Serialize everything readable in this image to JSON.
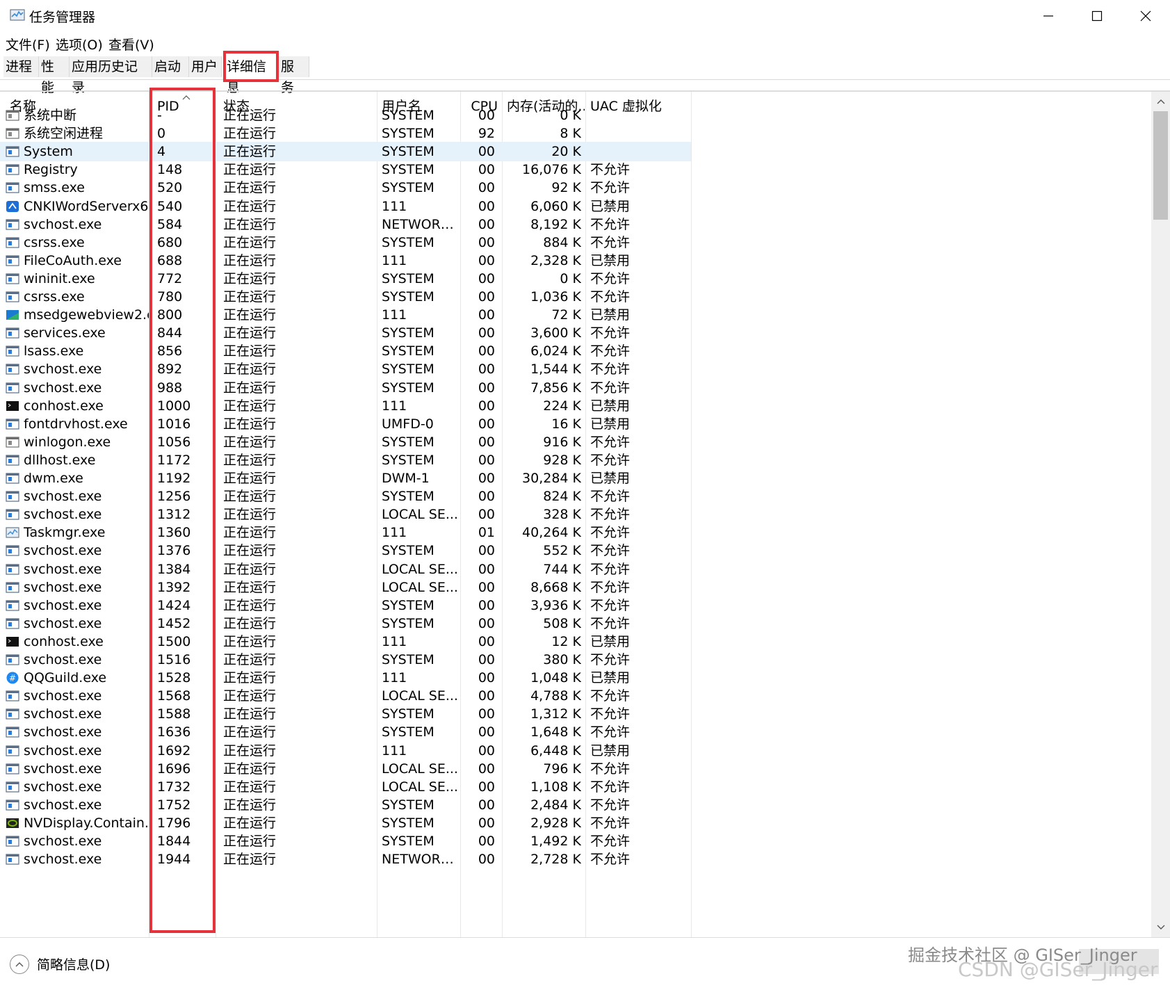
{
  "window": {
    "title": "任务管理器",
    "controls": [
      "minimize",
      "maximize",
      "close"
    ]
  },
  "menu": [
    "文件(F)",
    "选项(O)",
    "查看(V)"
  ],
  "tabs": [
    {
      "label": "进程"
    },
    {
      "label": "性能"
    },
    {
      "label": "应用历史记录"
    },
    {
      "label": "启动"
    },
    {
      "label": "用户"
    },
    {
      "label": "详细信息",
      "active": true
    },
    {
      "label": "服务"
    }
  ],
  "columns": {
    "name": "名称",
    "pid": "PID",
    "status": "状态",
    "user": "用户名",
    "cpu": "CPU",
    "mem": "内存(活动的...",
    "uac": "UAC 虚拟化"
  },
  "rows": [
    {
      "icon": "system-window-icon",
      "name": "系统中断",
      "pid": "-",
      "status": "正在运行",
      "user": "SYSTEM",
      "cpu": "00",
      "mem": "0 K",
      "uac": ""
    },
    {
      "icon": "system-window-icon",
      "name": "系统空闲进程",
      "pid": "0",
      "status": "正在运行",
      "user": "SYSTEM",
      "cpu": "92",
      "mem": "8 K",
      "uac": ""
    },
    {
      "icon": "app-window-icon",
      "name": "System",
      "pid": "4",
      "status": "正在运行",
      "user": "SYSTEM",
      "cpu": "00",
      "mem": "20 K",
      "uac": "",
      "selected": true
    },
    {
      "icon": "app-window-icon",
      "name": "Registry",
      "pid": "148",
      "status": "正在运行",
      "user": "SYSTEM",
      "cpu": "00",
      "mem": "16,076 K",
      "uac": "不允许"
    },
    {
      "icon": "app-window-icon",
      "name": "smss.exe",
      "pid": "520",
      "status": "正在运行",
      "user": "SYSTEM",
      "cpu": "00",
      "mem": "92 K",
      "uac": "不允许"
    },
    {
      "icon": "cnki-icon",
      "name": "CNKIWordServerx6...",
      "pid": "540",
      "status": "正在运行",
      "user": "111",
      "cpu": "00",
      "mem": "6,060 K",
      "uac": "已禁用"
    },
    {
      "icon": "app-window-icon",
      "name": "svchost.exe",
      "pid": "584",
      "status": "正在运行",
      "user": "NETWORK...",
      "cpu": "00",
      "mem": "8,192 K",
      "uac": "不允许"
    },
    {
      "icon": "app-window-icon",
      "name": "csrss.exe",
      "pid": "680",
      "status": "正在运行",
      "user": "SYSTEM",
      "cpu": "00",
      "mem": "884 K",
      "uac": "不允许"
    },
    {
      "icon": "app-window-icon",
      "name": "FileCoAuth.exe",
      "pid": "688",
      "status": "正在运行",
      "user": "111",
      "cpu": "00",
      "mem": "2,328 K",
      "uac": "已禁用"
    },
    {
      "icon": "app-window-icon",
      "name": "wininit.exe",
      "pid": "772",
      "status": "正在运行",
      "user": "SYSTEM",
      "cpu": "00",
      "mem": "0 K",
      "uac": "不允许"
    },
    {
      "icon": "app-window-icon",
      "name": "csrss.exe",
      "pid": "780",
      "status": "正在运行",
      "user": "SYSTEM",
      "cpu": "00",
      "mem": "1,036 K",
      "uac": "不允许"
    },
    {
      "icon": "edge-webview-icon",
      "name": "msedgewebview2.e...",
      "pid": "800",
      "status": "正在运行",
      "user": "111",
      "cpu": "00",
      "mem": "72 K",
      "uac": "已禁用"
    },
    {
      "icon": "app-window-icon",
      "name": "services.exe",
      "pid": "844",
      "status": "正在运行",
      "user": "SYSTEM",
      "cpu": "00",
      "mem": "3,600 K",
      "uac": "不允许"
    },
    {
      "icon": "app-window-icon",
      "name": "lsass.exe",
      "pid": "856",
      "status": "正在运行",
      "user": "SYSTEM",
      "cpu": "00",
      "mem": "6,024 K",
      "uac": "不允许"
    },
    {
      "icon": "app-window-icon",
      "name": "svchost.exe",
      "pid": "892",
      "status": "正在运行",
      "user": "SYSTEM",
      "cpu": "00",
      "mem": "1,544 K",
      "uac": "不允许"
    },
    {
      "icon": "app-window-icon",
      "name": "svchost.exe",
      "pid": "988",
      "status": "正在运行",
      "user": "SYSTEM",
      "cpu": "00",
      "mem": "7,856 K",
      "uac": "不允许"
    },
    {
      "icon": "console-icon",
      "name": "conhost.exe",
      "pid": "1000",
      "status": "正在运行",
      "user": "111",
      "cpu": "00",
      "mem": "224 K",
      "uac": "已禁用"
    },
    {
      "icon": "app-window-icon",
      "name": "fontdrvhost.exe",
      "pid": "1016",
      "status": "正在运行",
      "user": "UMFD-0",
      "cpu": "00",
      "mem": "16 K",
      "uac": "已禁用"
    },
    {
      "icon": "system-window-icon",
      "name": "winlogon.exe",
      "pid": "1056",
      "status": "正在运行",
      "user": "SYSTEM",
      "cpu": "00",
      "mem": "916 K",
      "uac": "不允许"
    },
    {
      "icon": "app-window-icon",
      "name": "dllhost.exe",
      "pid": "1172",
      "status": "正在运行",
      "user": "SYSTEM",
      "cpu": "00",
      "mem": "928 K",
      "uac": "不允许"
    },
    {
      "icon": "app-window-icon",
      "name": "dwm.exe",
      "pid": "1192",
      "status": "正在运行",
      "user": "DWM-1",
      "cpu": "00",
      "mem": "30,284 K",
      "uac": "已禁用"
    },
    {
      "icon": "app-window-icon",
      "name": "svchost.exe",
      "pid": "1256",
      "status": "正在运行",
      "user": "SYSTEM",
      "cpu": "00",
      "mem": "824 K",
      "uac": "不允许"
    },
    {
      "icon": "app-window-icon",
      "name": "svchost.exe",
      "pid": "1312",
      "status": "正在运行",
      "user": "LOCAL SE...",
      "cpu": "00",
      "mem": "328 K",
      "uac": "不允许"
    },
    {
      "icon": "taskmgr-icon",
      "name": "Taskmgr.exe",
      "pid": "1360",
      "status": "正在运行",
      "user": "111",
      "cpu": "01",
      "mem": "40,264 K",
      "uac": "不允许"
    },
    {
      "icon": "app-window-icon",
      "name": "svchost.exe",
      "pid": "1376",
      "status": "正在运行",
      "user": "SYSTEM",
      "cpu": "00",
      "mem": "552 K",
      "uac": "不允许"
    },
    {
      "icon": "app-window-icon",
      "name": "svchost.exe",
      "pid": "1384",
      "status": "正在运行",
      "user": "LOCAL SE...",
      "cpu": "00",
      "mem": "744 K",
      "uac": "不允许"
    },
    {
      "icon": "app-window-icon",
      "name": "svchost.exe",
      "pid": "1392",
      "status": "正在运行",
      "user": "LOCAL SE...",
      "cpu": "00",
      "mem": "8,668 K",
      "uac": "不允许"
    },
    {
      "icon": "app-window-icon",
      "name": "svchost.exe",
      "pid": "1424",
      "status": "正在运行",
      "user": "SYSTEM",
      "cpu": "00",
      "mem": "3,936 K",
      "uac": "不允许"
    },
    {
      "icon": "app-window-icon",
      "name": "svchost.exe",
      "pid": "1452",
      "status": "正在运行",
      "user": "SYSTEM",
      "cpu": "00",
      "mem": "508 K",
      "uac": "不允许"
    },
    {
      "icon": "console-icon",
      "name": "conhost.exe",
      "pid": "1500",
      "status": "正在运行",
      "user": "111",
      "cpu": "00",
      "mem": "12 K",
      "uac": "已禁用"
    },
    {
      "icon": "app-window-icon",
      "name": "svchost.exe",
      "pid": "1516",
      "status": "正在运行",
      "user": "SYSTEM",
      "cpu": "00",
      "mem": "380 K",
      "uac": "不允许"
    },
    {
      "icon": "qqguild-icon",
      "name": "QQGuild.exe",
      "pid": "1528",
      "status": "正在运行",
      "user": "111",
      "cpu": "00",
      "mem": "1,048 K",
      "uac": "已禁用"
    },
    {
      "icon": "app-window-icon",
      "name": "svchost.exe",
      "pid": "1568",
      "status": "正在运行",
      "user": "LOCAL SE...",
      "cpu": "00",
      "mem": "4,788 K",
      "uac": "不允许"
    },
    {
      "icon": "app-window-icon",
      "name": "svchost.exe",
      "pid": "1588",
      "status": "正在运行",
      "user": "SYSTEM",
      "cpu": "00",
      "mem": "1,312 K",
      "uac": "不允许"
    },
    {
      "icon": "app-window-icon",
      "name": "svchost.exe",
      "pid": "1636",
      "status": "正在运行",
      "user": "SYSTEM",
      "cpu": "00",
      "mem": "1,648 K",
      "uac": "不允许"
    },
    {
      "icon": "app-window-icon",
      "name": "svchost.exe",
      "pid": "1692",
      "status": "正在运行",
      "user": "111",
      "cpu": "00",
      "mem": "6,448 K",
      "uac": "已禁用"
    },
    {
      "icon": "app-window-icon",
      "name": "svchost.exe",
      "pid": "1696",
      "status": "正在运行",
      "user": "LOCAL SE...",
      "cpu": "00",
      "mem": "796 K",
      "uac": "不允许"
    },
    {
      "icon": "app-window-icon",
      "name": "svchost.exe",
      "pid": "1732",
      "status": "正在运行",
      "user": "LOCAL SE...",
      "cpu": "00",
      "mem": "1,108 K",
      "uac": "不允许"
    },
    {
      "icon": "app-window-icon",
      "name": "svchost.exe",
      "pid": "1752",
      "status": "正在运行",
      "user": "SYSTEM",
      "cpu": "00",
      "mem": "2,484 K",
      "uac": "不允许"
    },
    {
      "icon": "nvidia-icon",
      "name": "NVDisplay.Contain...",
      "pid": "1796",
      "status": "正在运行",
      "user": "SYSTEM",
      "cpu": "00",
      "mem": "2,928 K",
      "uac": "不允许"
    },
    {
      "icon": "app-window-icon",
      "name": "svchost.exe",
      "pid": "1844",
      "status": "正在运行",
      "user": "SYSTEM",
      "cpu": "00",
      "mem": "1,492 K",
      "uac": "不允许"
    },
    {
      "icon": "app-window-icon",
      "name": "svchost.exe",
      "pid": "1944",
      "status": "正在运行",
      "user": "NETWORK...",
      "cpu": "00",
      "mem": "2,728 K",
      "uac": "不允许"
    }
  ],
  "footer": {
    "brief_label": "简略信息(D)"
  },
  "watermark": {
    "line1": "掘金技术社区 @ GISer_Jinger",
    "line2": "CSDN @GISer_Jinger"
  },
  "colors": {
    "highlight_red": "#e5333b",
    "selected_row": "#e5f1fb"
  }
}
